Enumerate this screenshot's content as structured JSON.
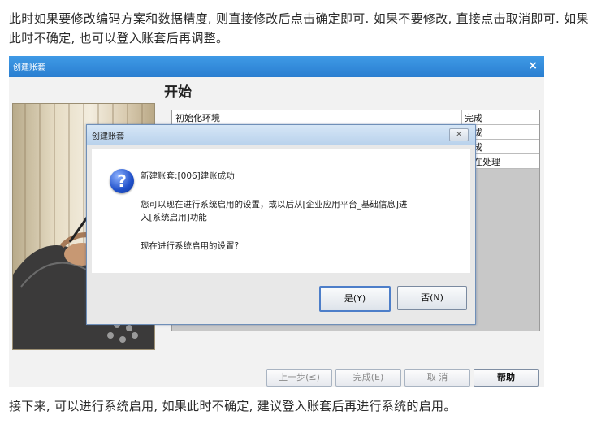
{
  "article": {
    "paragraph_top": "此时如果要修改编码方案和数据精度, 则直接修改后点击确定即可. 如果不要修改, 直接点击取消即可. 如果此时不确定, 也可以登入账套后再调整。",
    "paragraph_bottom": "接下来, 可以进行系统启用, 如果此时不确定, 建议登入账套后再进行系统的启用。"
  },
  "wizard": {
    "title": "创建账套",
    "close_glyph": "×",
    "heading": "开始",
    "progress_rows": [
      {
        "task": "初始化环境",
        "status": "完成"
      },
      {
        "task": "",
        "status": "完成"
      },
      {
        "task": "",
        "status": "完成"
      },
      {
        "task": "",
        "status": "正在处理"
      }
    ],
    "buttons": {
      "back": "上一步(≤)",
      "finish": "完成(E)",
      "cancel": "取 消",
      "help": "帮助"
    }
  },
  "dialog": {
    "title": "创建账套",
    "close_glyph": "✕",
    "icon": "question-icon",
    "line1": "新建账套:[006]建账成功",
    "line2": "您可以现在进行系统启用的设置，或以后从[企业应用平台_基础信息]进",
    "line3": "入[系统启用]功能",
    "line4": "现在进行系统启用的设置?",
    "yes_label": "是(Y)",
    "no_label": "否(N)"
  }
}
